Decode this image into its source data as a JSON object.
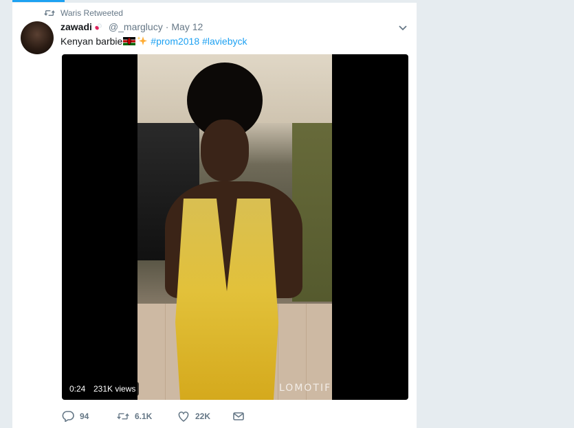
{
  "retweet_context": {
    "text": "Waris Retweeted",
    "icon": "retweet-icon"
  },
  "tweet": {
    "display_name": "zawadi",
    "handle": "@_marglucy",
    "separator": "·",
    "timestamp": "May 12",
    "text_prefix": "Kenyan barbie",
    "hashtags": [
      "#prom2018",
      "#laviebyck"
    ]
  },
  "media": {
    "duration": "0:24",
    "views": "231K views",
    "watermark": "LOMOTIF"
  },
  "actions": {
    "reply_count": "94",
    "retweet_count": "6.1K",
    "like_count": "22K"
  },
  "colors": {
    "accent": "#1da1f2",
    "muted": "#657786",
    "background": "#e6ecf0"
  }
}
